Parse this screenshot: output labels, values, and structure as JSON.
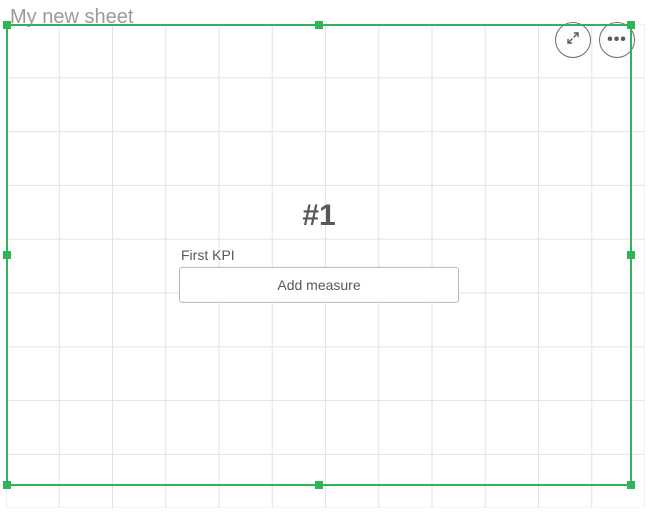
{
  "sheet": {
    "title": "My new sheet"
  },
  "toolbar": {
    "expand_tooltip": "Full screen",
    "more_tooltip": "More"
  },
  "object": {
    "tag": "#1",
    "first_kpi_label": "First KPI",
    "add_measure_label": "Add measure"
  },
  "colors": {
    "selection": "#2fb457"
  }
}
